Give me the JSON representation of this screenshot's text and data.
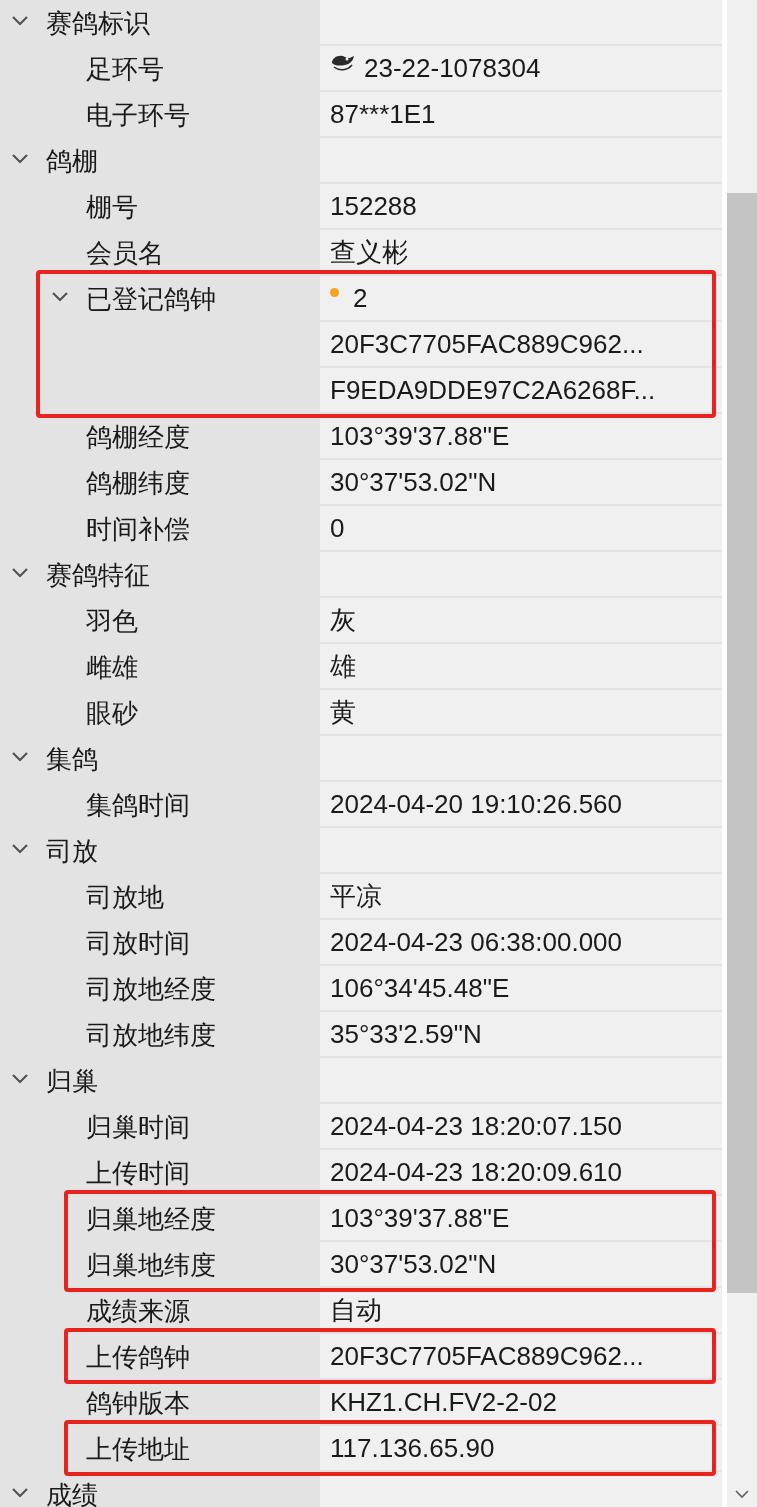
{
  "groups": [
    {
      "label": "赛鸽标识",
      "expanded": true,
      "children": [
        {
          "label": "足环号",
          "value": "23-22-1078304",
          "kind": "ring",
          "highlighted": false
        },
        {
          "label": "电子环号",
          "value": "87***1E1",
          "kind": "plain",
          "highlighted": false
        }
      ]
    },
    {
      "label": "鸽棚",
      "expanded": true,
      "children": [
        {
          "label": "棚号",
          "value": "152288",
          "kind": "plain",
          "highlighted": false
        },
        {
          "label": "会员名",
          "value": "查义彬",
          "kind": "plain",
          "highlighted": false
        },
        {
          "label": "已登记鸽钟",
          "value": "2",
          "kind": "count",
          "highlighted": true,
          "expanded": true,
          "children": [
            {
              "value": "20F3C7705FAC889C962...",
              "highlighted": true
            },
            {
              "value": "F9EDA9DDE97C2A6268F...",
              "highlighted": true
            }
          ]
        },
        {
          "label": "鸽棚经度",
          "value": "103°39'37.88\"E",
          "kind": "plain",
          "highlighted": false
        },
        {
          "label": "鸽棚纬度",
          "value": "30°37'53.02\"N",
          "kind": "plain",
          "highlighted": false
        },
        {
          "label": "时间补偿",
          "value": "0",
          "kind": "plain",
          "highlighted": false
        }
      ]
    },
    {
      "label": "赛鸽特征",
      "expanded": true,
      "children": [
        {
          "label": "羽色",
          "value": "灰",
          "kind": "plain",
          "highlighted": false
        },
        {
          "label": "雌雄",
          "value": "雄",
          "kind": "plain",
          "highlighted": false
        },
        {
          "label": "眼砂",
          "value": "黄",
          "kind": "plain",
          "highlighted": false
        }
      ]
    },
    {
      "label": "集鸽",
      "expanded": true,
      "children": [
        {
          "label": "集鸽时间",
          "value": "2024-04-20 19:10:26.560",
          "kind": "plain",
          "highlighted": false
        }
      ]
    },
    {
      "label": "司放",
      "expanded": true,
      "children": [
        {
          "label": "司放地",
          "value": "平凉",
          "kind": "plain",
          "highlighted": false
        },
        {
          "label": "司放时间",
          "value": "2024-04-23 06:38:00.000",
          "kind": "plain",
          "highlighted": false
        },
        {
          "label": "司放地经度",
          "value": "106°34'45.48\"E",
          "kind": "plain",
          "highlighted": false
        },
        {
          "label": "司放地纬度",
          "value": "35°33'2.59\"N",
          "kind": "plain",
          "highlighted": false
        }
      ]
    },
    {
      "label": "归巢",
      "expanded": true,
      "children": [
        {
          "label": "归巢时间",
          "value": "2024-04-23 18:20:07.150",
          "kind": "plain",
          "highlighted": false
        },
        {
          "label": "上传时间",
          "value": "2024-04-23 18:20:09.610",
          "kind": "plain",
          "highlighted": false
        },
        {
          "label": "归巢地经度",
          "value": "103°39'37.88\"E",
          "kind": "plain",
          "highlighted": true
        },
        {
          "label": "归巢地纬度",
          "value": "30°37'53.02\"N",
          "kind": "plain",
          "highlighted": true
        },
        {
          "label": "成绩来源",
          "value": "自动",
          "kind": "plain",
          "highlighted": false
        },
        {
          "label": "上传鸽钟",
          "value": "20F3C7705FAC889C962...",
          "kind": "plain",
          "highlighted": true
        },
        {
          "label": "鸽钟版本",
          "value": "KHZ1.CH.FV2-2-02",
          "kind": "plain",
          "highlighted": false
        },
        {
          "label": "上传地址",
          "value": "117.136.65.90",
          "kind": "plain",
          "highlighted": true
        }
      ]
    },
    {
      "label": "成绩",
      "expanded": true
    }
  ]
}
